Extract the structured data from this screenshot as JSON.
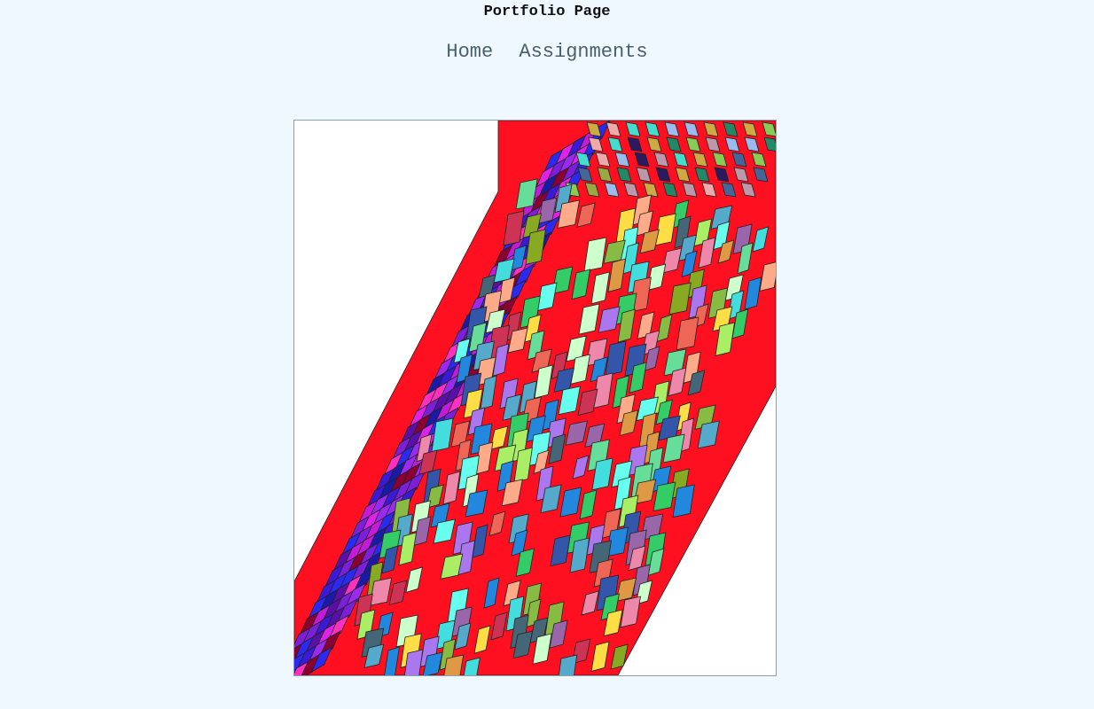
{
  "page": {
    "title": "Portfolio Page"
  },
  "nav": {
    "items": [
      {
        "label": "Home"
      },
      {
        "label": "Assignments"
      }
    ]
  },
  "artwork": {
    "background_color": "#ffffff",
    "base_color": "#ff1020",
    "side_palette": [
      "#7b1fd8",
      "#3a1ad6",
      "#c41bd8",
      "#5a10a8",
      "#2a2af0",
      "#e022e8",
      "#8b0030",
      "#1a1aa8",
      "#9a2af0",
      "#ff30c0"
    ],
    "tile_palette": [
      "#33cc66",
      "#66dd99",
      "#2288dd",
      "#aa77ee",
      "#ee6655",
      "#ffdd44",
      "#88bb44",
      "#44dddd",
      "#cc3355",
      "#dd9944",
      "#55aacc",
      "#aaee66",
      "#9966aa",
      "#ee88aa",
      "#3355aa",
      "#ccffcc",
      "#66ffee",
      "#88aa22",
      "#ffaa88",
      "#446677"
    ],
    "top_palette": [
      "#2a1a60",
      "#446699",
      "#99aa44",
      "#bb99aa",
      "#44ddcc",
      "#228866",
      "#88cc55",
      "#99bbee",
      "#eeaaaa",
      "#ccaa44"
    ]
  }
}
